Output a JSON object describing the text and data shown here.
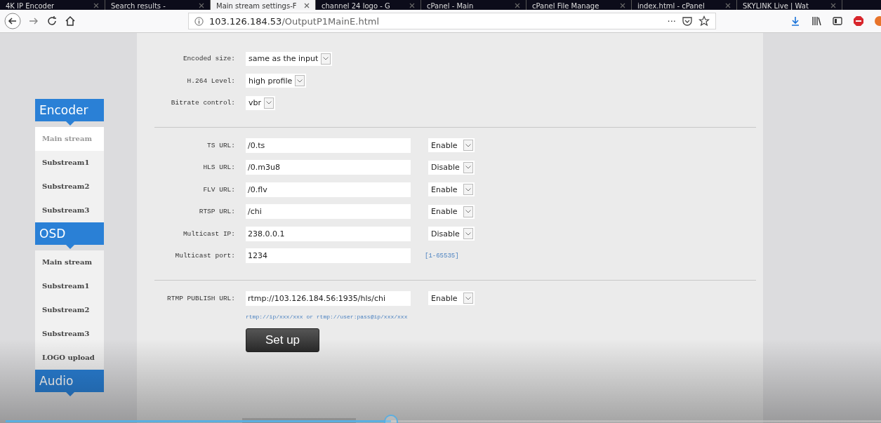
{
  "browser": {
    "tabs": [
      {
        "label": "4K IP Encoder",
        "selected": false
      },
      {
        "label": "Search results -",
        "selected": false
      },
      {
        "label": "Main stream settings-F",
        "selected": true
      },
      {
        "label": "channel 24 logo - G",
        "selected": false
      },
      {
        "label": "cPanel - Main",
        "selected": false
      },
      {
        "label": "cPanel File Manage",
        "selected": false
      },
      {
        "label": "index.html - cPanel",
        "selected": false
      },
      {
        "label": "SKYLINK Live | Wat",
        "selected": false
      }
    ],
    "address": {
      "host": "103.126.184.53",
      "path": "/OutputP1MainE.html"
    },
    "page_actions": "···"
  },
  "sidebar": [
    {
      "title": "Encoder",
      "items": [
        {
          "label": "Main stream",
          "selected": true
        },
        {
          "label": "Substream1",
          "selected": false
        },
        {
          "label": "Substream2",
          "selected": false
        },
        {
          "label": "Substream3",
          "selected": false
        }
      ]
    },
    {
      "title": "OSD",
      "items": [
        {
          "label": "Main stream",
          "selected": false
        },
        {
          "label": "Substream1",
          "selected": false
        },
        {
          "label": "Substream2",
          "selected": false
        },
        {
          "label": "Substream3",
          "selected": false
        },
        {
          "label": "LOGO upload",
          "selected": false
        }
      ]
    },
    {
      "title": "Audio"
    }
  ],
  "settings": [
    {
      "label": "Encoded size:",
      "value": "same as the input"
    },
    {
      "label": "H.264 Level:",
      "value": "high profile"
    },
    {
      "label": "Bitrate control:",
      "value": "vbr"
    }
  ],
  "outputs": [
    {
      "label": "TS URL:",
      "value": "/0.ts",
      "toggle": "Enable"
    },
    {
      "label": "HLS URL:",
      "value": "/0.m3u8",
      "toggle": "Disable"
    },
    {
      "label": "FLV URL:",
      "value": "/0.flv",
      "toggle": "Enable"
    },
    {
      "label": "RTSP URL:",
      "value": "/chi",
      "toggle": "Enable"
    },
    {
      "label": "Multicast IP:",
      "value": "238.0.0.1",
      "toggle": "Disable"
    },
    {
      "label": "Multicast port:",
      "value": "1234",
      "range": "[1-65535]"
    }
  ],
  "publish": {
    "label": "RTMP PUBLISH URL:",
    "value": "rtmp://103.126.184.56:1935/hls/chi",
    "toggle": "Enable",
    "hint": "rtmp://ip/xxx/xxx or rtmp://user:pass@ip/xxx/xxx"
  },
  "submit": "Set up",
  "player": {
    "level": 0.44
  }
}
